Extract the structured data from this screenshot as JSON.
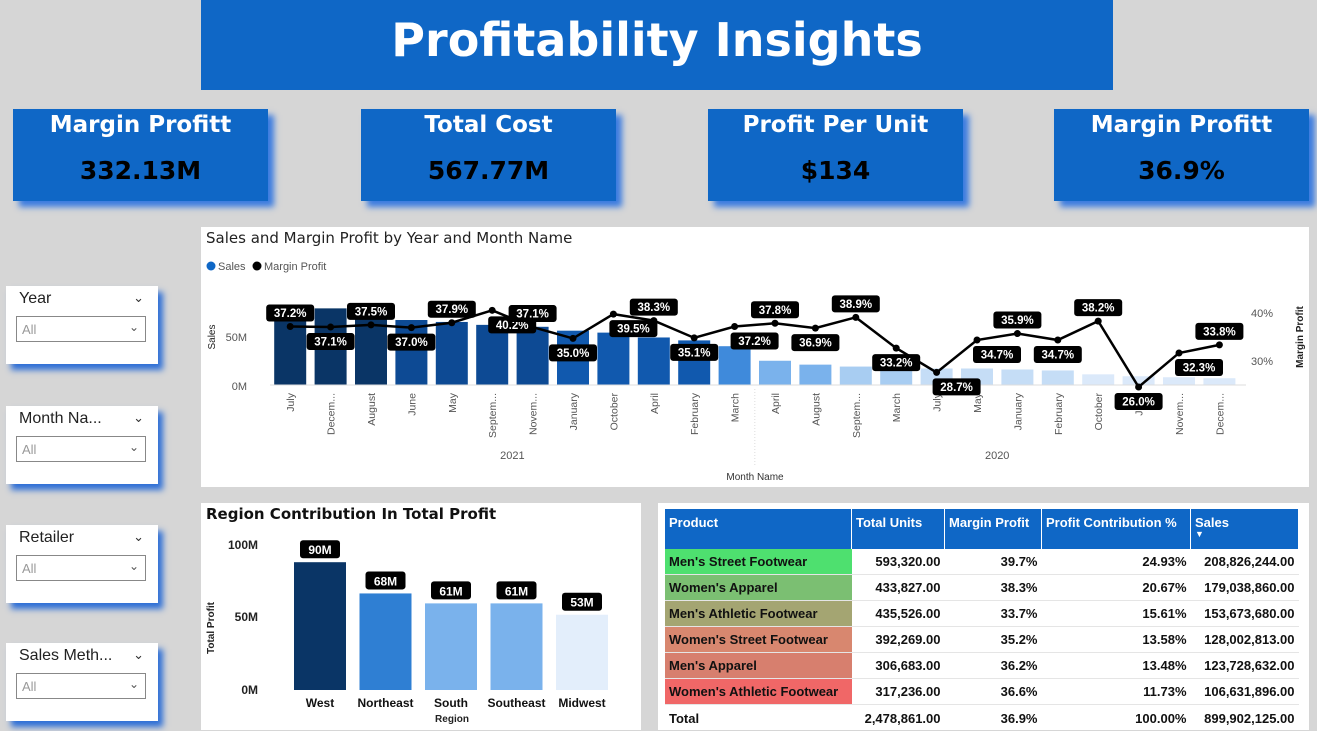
{
  "title": "Profitability Insights",
  "kpis": [
    {
      "label": "Margin Profitt",
      "value": "332.13M"
    },
    {
      "label": "Total Cost",
      "value": "567.77M"
    },
    {
      "label": "Profit Per Unit",
      "value": "$134"
    },
    {
      "label": "Margin Profitt",
      "value": "36.9%"
    }
  ],
  "slicers": [
    {
      "name": "Year",
      "value": "All"
    },
    {
      "name": "Month Na...",
      "value": "All"
    },
    {
      "name": "Retailer",
      "value": "All"
    },
    {
      "name": "Sales Meth...",
      "value": "All"
    }
  ],
  "colors": {
    "accent": "#0f67c6",
    "dark": "#08325f",
    "sales_2021": [
      "#0a3566",
      "#0b3f7c",
      "#0d4a94",
      "#1159ae",
      "#2f7fd3",
      "#3f8adb"
    ],
    "sales_2020": [
      "#7ab2ec",
      "#a8cdf2",
      "#c5ddf6",
      "#dbe9fa",
      "#e7f0fc"
    ]
  },
  "chart_data": [
    {
      "type": "bar+line",
      "title": "Sales and Margin Profit by Year and Month Name",
      "legend": [
        "Sales",
        "Margin Profit"
      ],
      "ylabel": "Sales",
      "y2label": "Margin Profit",
      "xlabel": "Month Name",
      "yticks": [
        "0M",
        "50M"
      ],
      "y2ticks": [
        "30%",
        "40%"
      ],
      "ylim": [
        0,
        100
      ],
      "y2lim": [
        20,
        45
      ],
      "groups": [
        {
          "label": "2021",
          "start": 0,
          "end": 12
        },
        {
          "label": "2020",
          "start": 12,
          "end": 24
        }
      ],
      "categories": [
        "July",
        "Decem...",
        "August",
        "June",
        "May",
        "Septem...",
        "Novem...",
        "January",
        "October",
        "April",
        "February",
        "March",
        "April",
        "August",
        "Septem...",
        "March",
        "July",
        "May",
        "January",
        "February",
        "October",
        "June",
        "Novem...",
        "Decem..."
      ],
      "sales": [
        80,
        79,
        74,
        67,
        65,
        62,
        60,
        56,
        54,
        49,
        46,
        40,
        25,
        21,
        19,
        18,
        17,
        17,
        16,
        15,
        11,
        9,
        8,
        7
      ],
      "margin": [
        37.2,
        37.1,
        37.5,
        37.0,
        37.9,
        40.2,
        37.1,
        35.0,
        39.5,
        38.3,
        35.1,
        37.2,
        37.8,
        36.9,
        38.9,
        33.2,
        28.7,
        34.7,
        35.9,
        34.7,
        38.2,
        26.0,
        32.3,
        33.8
      ],
      "margin_labels": [
        "37.2%",
        "37.1%",
        "37.5%",
        "37.0%",
        "37.9%",
        "40.2%",
        "37.1%",
        "35.0%",
        "39.5%",
        "38.3%",
        "35.1%",
        "37.2%",
        "37.8%",
        "36.9%",
        "38.9%",
        "33.2%",
        "28.7%",
        "34.7%",
        "35.9%",
        "34.7%",
        "38.2%",
        "26.0%",
        "32.3%",
        "33.8%"
      ]
    },
    {
      "type": "bar",
      "title": "Region Contribution In Total Profit",
      "ylabel": "Total Profit",
      "xlabel": "Region",
      "yticks": [
        "0M",
        "50M",
        "100M"
      ],
      "ylim": [
        0,
        100
      ],
      "categories": [
        "West",
        "Northeast",
        "South",
        "Southeast",
        "Midwest"
      ],
      "values": [
        90,
        68,
        61,
        61,
        53
      ],
      "labels": [
        "90M",
        "68M",
        "61M",
        "61M",
        "53M"
      ]
    }
  ],
  "table": {
    "headers": [
      "Product",
      "Total Units",
      "Margin Profit",
      "Profit Contribution %",
      "Sales"
    ],
    "rows": [
      {
        "product": "Men's Street Footwear",
        "units": "593,320.00",
        "margin": "39.7%",
        "contrib": "24.93%",
        "sales": "208,826,244.00",
        "color": "#4ee06f"
      },
      {
        "product": "Women's Apparel",
        "units": "433,827.00",
        "margin": "38.3%",
        "contrib": "20.67%",
        "sales": "179,038,860.00",
        "color": "#7bbf72"
      },
      {
        "product": "Men's Athletic Footwear",
        "units": "435,526.00",
        "margin": "33.7%",
        "contrib": "15.61%",
        "sales": "153,673,680.00",
        "color": "#a4a572"
      },
      {
        "product": "Women's Street Footwear",
        "units": "392,269.00",
        "margin": "35.2%",
        "contrib": "13.58%",
        "sales": "128,002,813.00",
        "color": "#d8876f"
      },
      {
        "product": "Men's Apparel",
        "units": "306,683.00",
        "margin": "36.2%",
        "contrib": "13.48%",
        "sales": "123,728,632.00",
        "color": "#d77f6e"
      },
      {
        "product": "Women's Athletic Footwear",
        "units": "317,236.00",
        "margin": "36.6%",
        "contrib": "11.73%",
        "sales": "106,631,896.00",
        "color": "#f06767"
      }
    ],
    "total": {
      "label": "Total",
      "units": "2,478,861.00",
      "margin": "36.9%",
      "contrib": "100.00%",
      "sales": "899,902,125.00"
    }
  }
}
